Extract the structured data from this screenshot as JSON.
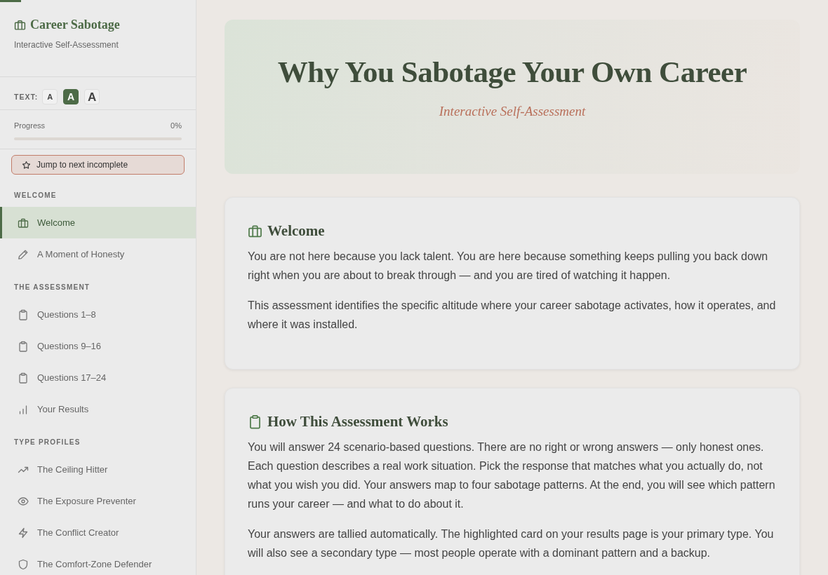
{
  "reading_progress": {
    "level": 0.025
  },
  "sidebar": {
    "brand": {
      "title": "Career Sabotage",
      "subtitle": "Interactive Self-Assessment"
    },
    "text_size": {
      "label": "TEXT:",
      "options": [
        {
          "label": "A",
          "kind": "small",
          "selected": false
        },
        {
          "label": "A",
          "kind": "medium",
          "selected": true
        },
        {
          "label": "A",
          "kind": "large",
          "selected": false
        }
      ]
    },
    "progress": {
      "label": "Progress",
      "reading": "0%",
      "level": 0
    },
    "jump_button": {
      "label": "Jump to next incomplete"
    },
    "sections": [
      {
        "title": "WELCOME",
        "items": [
          {
            "label": "Welcome",
            "kind": "briefcase",
            "selected": true
          },
          {
            "label": "A Moment of Honesty",
            "kind": "pencil",
            "selected": false
          }
        ]
      },
      {
        "title": "THE ASSESSMENT",
        "items": [
          {
            "label": "Questions 1–8",
            "kind": "clipboard",
            "selected": false
          },
          {
            "label": "Questions 9–16",
            "kind": "clipboard",
            "selected": false
          },
          {
            "label": "Questions 17–24",
            "kind": "clipboard",
            "selected": false
          },
          {
            "label": "Your Results",
            "kind": "chart",
            "selected": false
          }
        ]
      },
      {
        "title": "TYPE PROFILES",
        "items": [
          {
            "label": "The Ceiling Hitter",
            "kind": "trend",
            "selected": false
          },
          {
            "label": "The Exposure Preventer",
            "kind": "eye",
            "selected": false
          },
          {
            "label": "The Conflict Creator",
            "kind": "bolt",
            "selected": false
          },
          {
            "label": "The Comfort-Zone Defender",
            "kind": "shield",
            "selected": false
          }
        ]
      }
    ]
  },
  "header": {
    "title": "Why You Sabotage Your Own Career",
    "subtitle": "Interactive Self-Assessment"
  },
  "cards": [
    {
      "title": "Welcome",
      "kind": "briefcase",
      "paragraphs": [
        "You are not here because you lack talent. You are here because something keeps pulling you back down right when you are about to break through — and you are tired of watching it happen.",
        "This assessment identifies the specific altitude where your career sabotage activates, how it operates, and where it was installed."
      ]
    },
    {
      "title": "How This Assessment Works",
      "kind": "clipboard",
      "paragraphs": [
        "You will answer 24 scenario-based questions. There are no right or wrong answers — only honest ones. Each question describes a real work situation. Pick the response that matches what you actually do, not what you wish you did. Your answers map to four sabotage patterns. At the end, you will see which pattern runs your career — and what to do about it.",
        "Your answers are tallied automatically. The highlighted card on your results page is your primary type. You will also see a secondary type — most people operate with a dominant pattern and a backup."
      ]
    }
  ]
}
